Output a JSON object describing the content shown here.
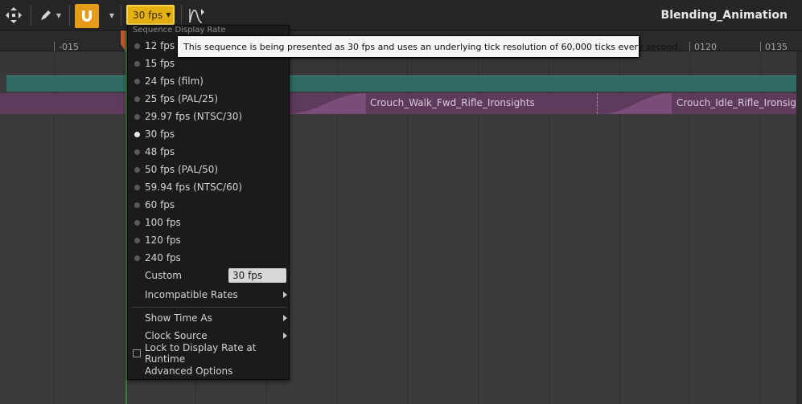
{
  "toolbar": {
    "fps_label": "30 fps",
    "sequence_name": "Blending_Animation",
    "icons": [
      "transform-icon",
      "pencil-icon",
      "magnet-icon",
      "curve-icon"
    ]
  },
  "ruler": {
    "labels": [
      "-015",
      "0120",
      "0135"
    ]
  },
  "clips": {
    "clip1": "Crouch_Walk_Fwd_Rifle_Ironsights",
    "clip2": "Crouch_Idle_Rifle_Ironsights"
  },
  "menu": {
    "heading": "Sequence Display Rate",
    "rates": [
      {
        "label": "12 fps",
        "selected": false
      },
      {
        "label": "15 fps",
        "selected": false
      },
      {
        "label": "24 fps (film)",
        "selected": false
      },
      {
        "label": "25 fps (PAL/25)",
        "selected": false
      },
      {
        "label": "29.97 fps (NTSC/30)",
        "selected": false
      },
      {
        "label": "30 fps",
        "selected": true
      },
      {
        "label": "48 fps",
        "selected": false
      },
      {
        "label": "50 fps (PAL/50)",
        "selected": false
      },
      {
        "label": "59.94 fps (NTSC/60)",
        "selected": false
      },
      {
        "label": "60 fps",
        "selected": false
      },
      {
        "label": "100 fps",
        "selected": false
      },
      {
        "label": "120 fps",
        "selected": false
      },
      {
        "label": "240 fps",
        "selected": false
      }
    ],
    "custom_label": "Custom",
    "custom_value": "30 fps",
    "incompatible_rates": "Incompatible Rates",
    "show_time_as": "Show Time As",
    "clock_source": "Clock Source",
    "lock_display_rate": "Lock to Display Rate at Runtime",
    "advanced_options": "Advanced Options"
  },
  "tooltip": {
    "text": "This sequence is being presented as 30 fps and uses an underlying tick resolution of 60,000 ticks every second."
  },
  "colors": {
    "accent": "#e5b014",
    "magnet": "#e49b17",
    "teal_track": "#2f6b63",
    "purple_track": "#5e3a5d"
  }
}
